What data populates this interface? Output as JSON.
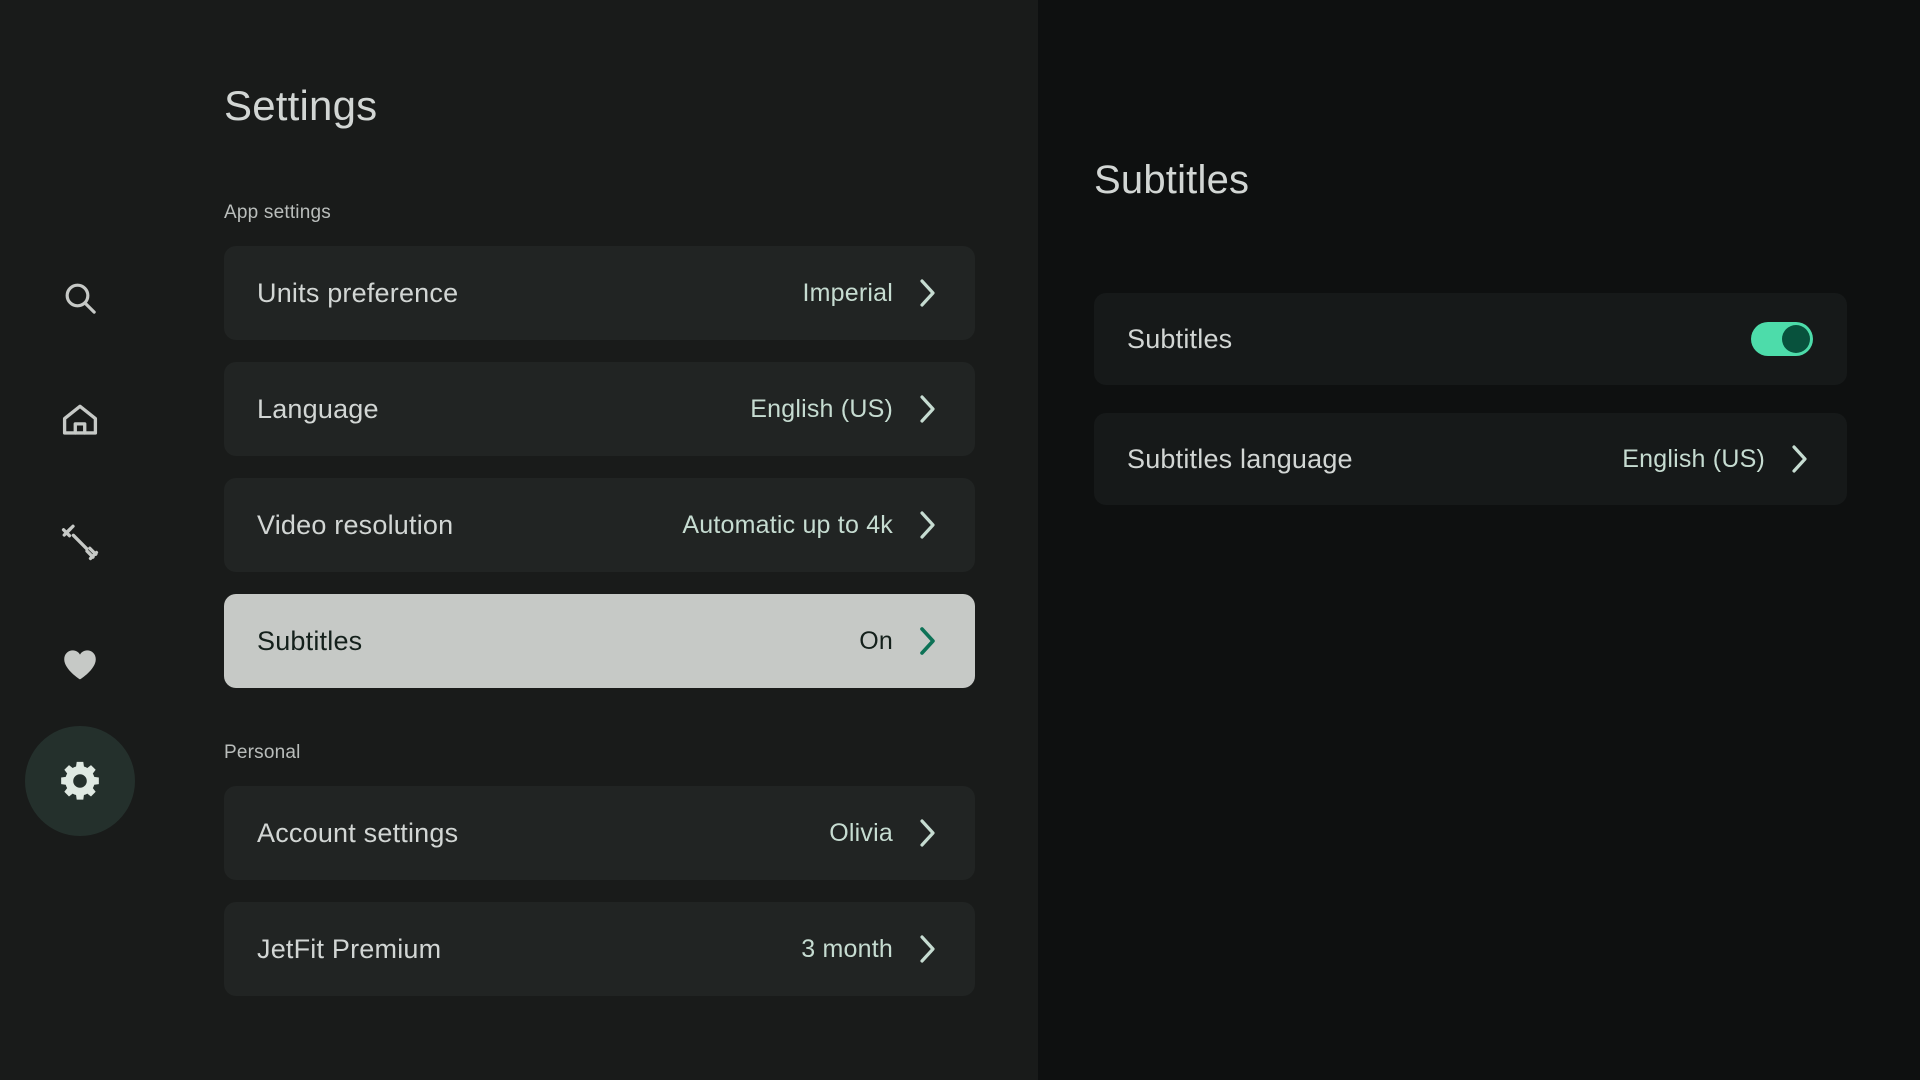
{
  "sidebar": {
    "items": [
      {
        "name": "search",
        "icon": "search-icon",
        "active": false
      },
      {
        "name": "home",
        "icon": "home-icon",
        "active": false
      },
      {
        "name": "workouts",
        "icon": "dumbbell-icon",
        "active": false
      },
      {
        "name": "favorites",
        "icon": "heart-icon",
        "active": false
      },
      {
        "name": "settings",
        "icon": "gear-icon",
        "active": true
      }
    ]
  },
  "settings": {
    "title": "Settings",
    "groups": [
      {
        "label": "App settings",
        "rows": [
          {
            "label": "Units preference",
            "value": "Imperial",
            "selected": false
          },
          {
            "label": "Language",
            "value": "English (US)",
            "selected": false
          },
          {
            "label": "Video resolution",
            "value": "Automatic up to 4k",
            "selected": false
          },
          {
            "label": "Subtitles",
            "value": "On",
            "selected": true
          }
        ]
      },
      {
        "label": "Personal",
        "rows": [
          {
            "label": "Account settings",
            "value": "Olivia",
            "selected": false
          },
          {
            "label": "JetFit Premium",
            "value": "3 month",
            "selected": false
          }
        ]
      }
    ]
  },
  "detail": {
    "title": "Subtitles",
    "toggle_row": {
      "label": "Subtitles",
      "toggle_state": "on"
    },
    "language_row": {
      "label": "Subtitles language",
      "value": "English (US)"
    }
  },
  "colors": {
    "left_panel_bg": "#191b1a",
    "right_panel_bg": "#0e1010",
    "row_bg": "#212423",
    "detail_row_bg": "#161919",
    "selected_row_bg": "#c6c9c6",
    "accent_mint": "#c6dcd1",
    "toggle_on": "#4ddcaa",
    "toggle_knob": "#08523d",
    "selected_chevron": "#0d7256",
    "active_nav_pill": "#24302c",
    "text_primary": "#d2d6d4"
  }
}
